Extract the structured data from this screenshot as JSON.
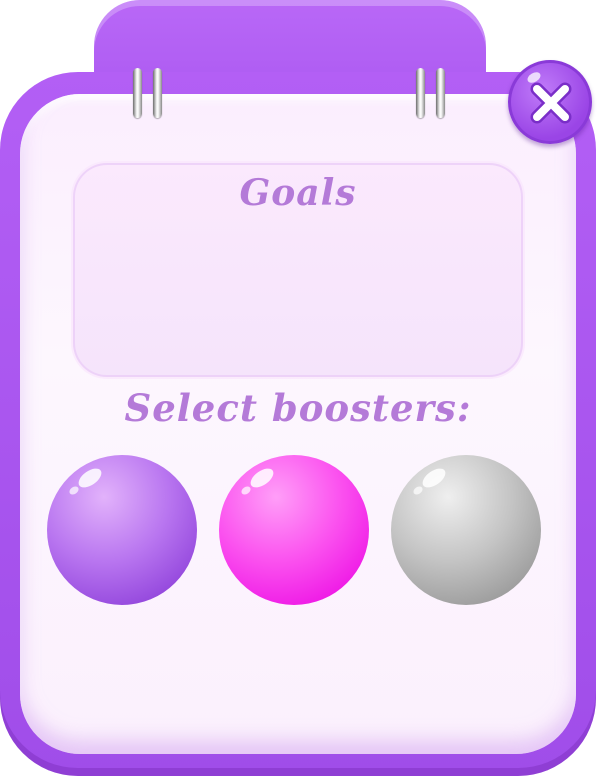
{
  "dialog": {
    "goals_title": "Goals",
    "boosters_label": "Select boosters:",
    "close_icon": "close-x-icon",
    "colors": {
      "frame": "#a653ee",
      "panel": "#fdf7fe",
      "title_text": "#b47ad8"
    }
  },
  "boosters": [
    {
      "icon": "purple-orb",
      "color": "#9a4fe0"
    },
    {
      "icon": "pink-orb",
      "color": "#fb52ef"
    },
    {
      "icon": "gray-orb",
      "color": "#9d9d9d"
    }
  ]
}
